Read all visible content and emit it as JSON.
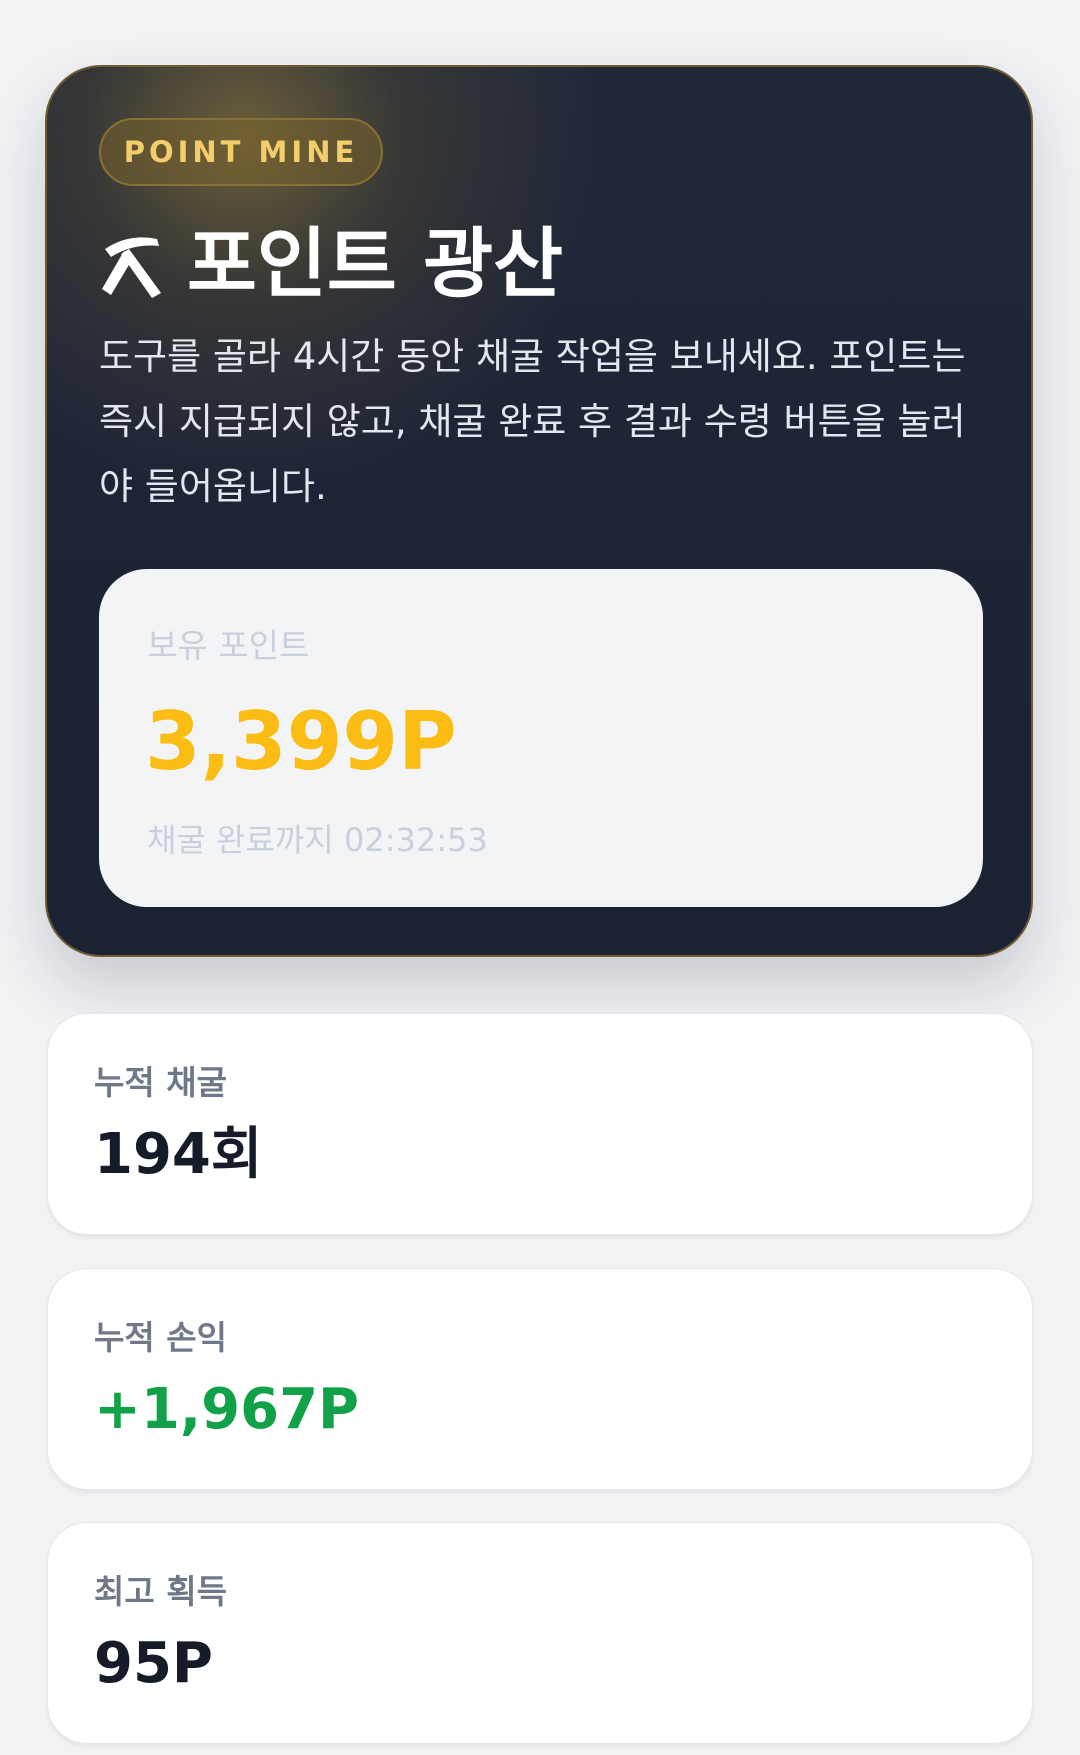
{
  "hero": {
    "badge": "POINT MINE",
    "title_icon": "pickaxe-icon",
    "title": "포인트 광산",
    "description": "도구를 골라 4시간 동안 채굴 작업을 보내세요. 포인트는 즉시 지급되지 않고, 채굴 완료 후 결과 수령 버튼을 눌러야 들어옵니다.",
    "balance": {
      "label": "보유 포인트",
      "value": "3,399P",
      "timer": "채굴 완료까지 02:32:53"
    }
  },
  "stats": [
    {
      "label": "누적 채굴",
      "value": "194회"
    },
    {
      "label": "누적 손익",
      "value": "+1,967P"
    },
    {
      "label": "최고 획득",
      "value": "95P"
    }
  ],
  "colors": {
    "gold": "#fbbd14",
    "badge_text": "#f2cf6a",
    "positive": "#11a148",
    "dark_card": "#1c2335"
  }
}
